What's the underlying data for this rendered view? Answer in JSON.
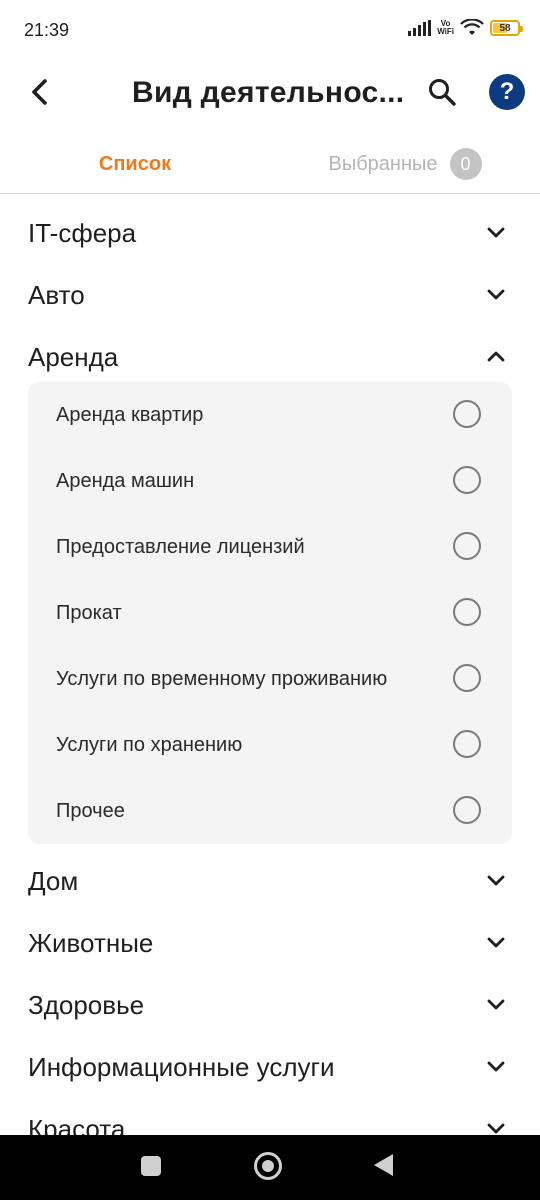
{
  "status_bar": {
    "time": "21:39",
    "network_label_top": "Vo",
    "network_label_bottom": "WiFi",
    "battery_level": "58"
  },
  "app_bar": {
    "title": "Вид деятельнос...",
    "back_icon": "chevron-left-icon",
    "search_icon": "search-icon",
    "help_label": "?"
  },
  "tabs": {
    "list_label": "Список",
    "selected_label": "Выбранные",
    "selected_count": "0",
    "active_color": "#f07a1a",
    "inactive_color": "#b5b5b5"
  },
  "categories": [
    {
      "label": "IT-сфера",
      "expanded": false
    },
    {
      "label": "Авто",
      "expanded": false
    },
    {
      "label": "Аренда",
      "expanded": true,
      "items": [
        {
          "label": "Аренда квартир",
          "checked": false
        },
        {
          "label": "Аренда машин",
          "checked": false
        },
        {
          "label": "Предоставление лицензий",
          "checked": false
        },
        {
          "label": "Прокат",
          "checked": false
        },
        {
          "label": "Услуги по временному проживанию",
          "checked": false
        },
        {
          "label": "Услуги по хранению",
          "checked": false
        },
        {
          "label": "Прочее",
          "checked": false
        }
      ]
    },
    {
      "label": "Дом",
      "expanded": false
    },
    {
      "label": "Животные",
      "expanded": false
    },
    {
      "label": "Здоровье",
      "expanded": false
    },
    {
      "label": "Информационные услуги",
      "expanded": false
    },
    {
      "label": "Красота",
      "expanded": false
    }
  ],
  "colors": {
    "accent": "#f07a1a",
    "help_button": "#0d3b82",
    "panel_bg": "#f4f4f4"
  }
}
